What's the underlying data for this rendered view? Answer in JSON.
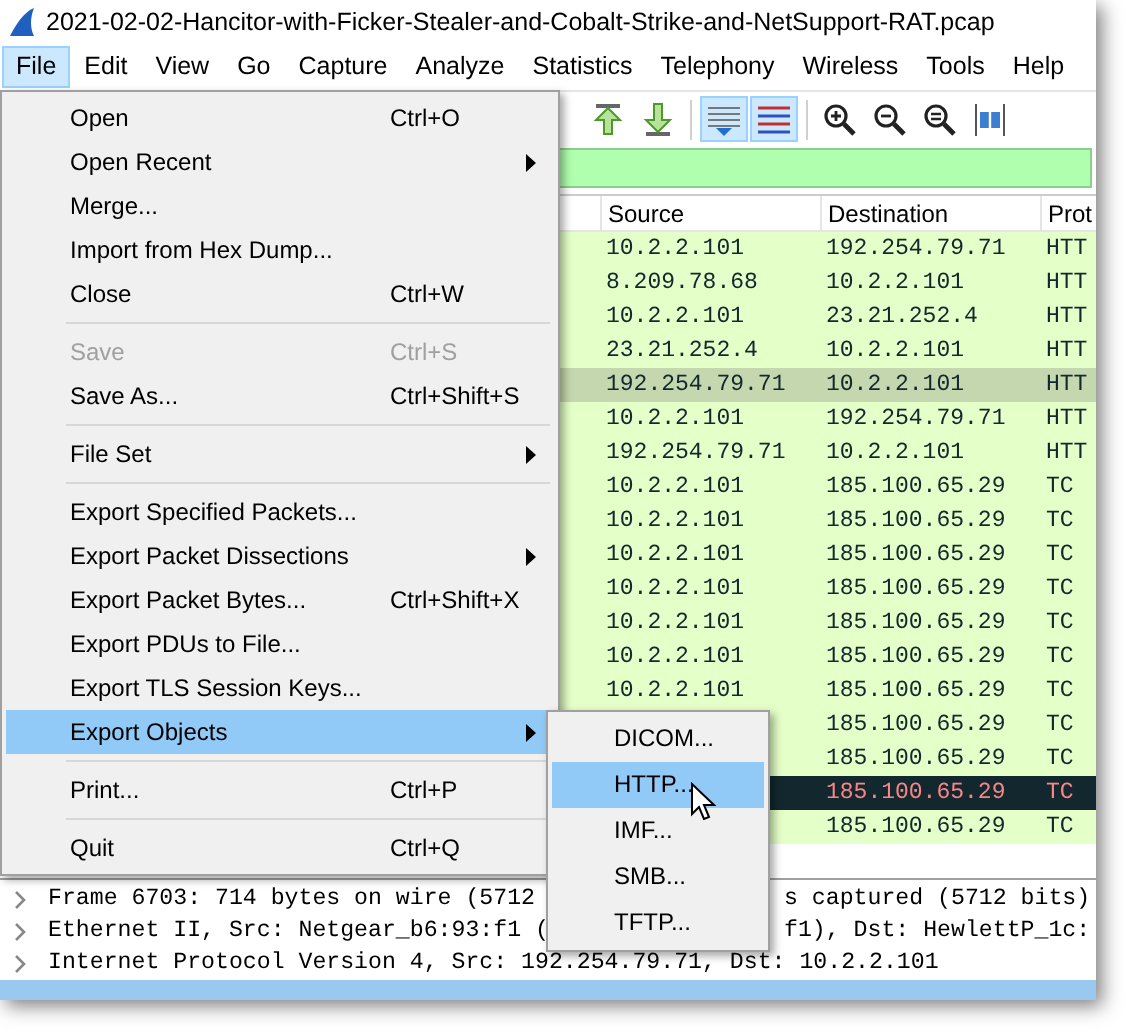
{
  "window": {
    "title": "2021-02-02-Hancitor-with-Ficker-Stealer-and-Cobalt-Strike-and-NetSupport-RAT.pcap"
  },
  "menubar": [
    {
      "label": "File",
      "selected": true
    },
    {
      "label": "Edit",
      "selected": false
    },
    {
      "label": "View",
      "selected": false
    },
    {
      "label": "Go",
      "selected": false
    },
    {
      "label": "Capture",
      "selected": false
    },
    {
      "label": "Analyze",
      "selected": false
    },
    {
      "label": "Statistics",
      "selected": false
    },
    {
      "label": "Telephony",
      "selected": false
    },
    {
      "label": "Wireless",
      "selected": false
    },
    {
      "label": "Tools",
      "selected": false
    },
    {
      "label": "Help",
      "selected": false
    }
  ],
  "toolbar": [
    {
      "kind": "go-first",
      "pressed": false
    },
    {
      "kind": "go-last",
      "pressed": false
    },
    {
      "kind": "autoscroll",
      "pressed": true
    },
    {
      "kind": "colorize",
      "pressed": true
    },
    {
      "kind": "zoom-in",
      "pressed": false
    },
    {
      "kind": "zoom-out",
      "pressed": false
    },
    {
      "kind": "zoom-reset",
      "pressed": false
    },
    {
      "kind": "resize-columns",
      "pressed": false
    }
  ],
  "packet_list": {
    "columns": [
      "Source",
      "Destination",
      "Prot"
    ],
    "rows": [
      {
        "source": "10.2.2.101",
        "destination": "192.254.79.71",
        "protocol": "HTT",
        "kind": "http",
        "selected": false
      },
      {
        "source": "8.209.78.68",
        "destination": "10.2.2.101",
        "protocol": "HTT",
        "kind": "http",
        "selected": false
      },
      {
        "source": "10.2.2.101",
        "destination": "23.21.252.4",
        "protocol": "HTT",
        "kind": "http",
        "selected": false
      },
      {
        "source": "23.21.252.4",
        "destination": "10.2.2.101",
        "protocol": "HTT",
        "kind": "http",
        "selected": false
      },
      {
        "source": "192.254.79.71",
        "destination": "10.2.2.101",
        "protocol": "HTT",
        "kind": "http",
        "selected": true
      },
      {
        "source": "10.2.2.101",
        "destination": "192.254.79.71",
        "protocol": "HTT",
        "kind": "http",
        "selected": false
      },
      {
        "source": "192.254.79.71",
        "destination": "10.2.2.101",
        "protocol": "HTT",
        "kind": "http",
        "selected": false
      },
      {
        "source": "10.2.2.101",
        "destination": "185.100.65.29",
        "protocol": "TC",
        "kind": "tcp",
        "selected": false
      },
      {
        "source": "10.2.2.101",
        "destination": "185.100.65.29",
        "protocol": "TC",
        "kind": "tcp",
        "selected": false
      },
      {
        "source": "10.2.2.101",
        "destination": "185.100.65.29",
        "protocol": "TC",
        "kind": "tcp",
        "selected": false
      },
      {
        "source": "10.2.2.101",
        "destination": "185.100.65.29",
        "protocol": "TC",
        "kind": "tcp",
        "selected": false
      },
      {
        "source": "10.2.2.101",
        "destination": "185.100.65.29",
        "protocol": "TC",
        "kind": "tcp",
        "selected": false
      },
      {
        "source": "10.2.2.101",
        "destination": "185.100.65.29",
        "protocol": "TC",
        "kind": "tcp",
        "selected": false
      },
      {
        "source": "10.2.2.101",
        "destination": "185.100.65.29",
        "protocol": "TC",
        "kind": "tcp",
        "selected": false
      },
      {
        "destination": "185.100.65.29",
        "protocol": "TC",
        "kind": "tcp",
        "selected": false
      },
      {
        "destination": "185.100.65.29",
        "protocol": "TC",
        "kind": "tcp",
        "selected": false
      },
      {
        "destination": "185.100.65.29",
        "protocol": "TC",
        "kind": "bad-tcp",
        "selected": false
      },
      {
        "destination": "185.100.65.29",
        "protocol": "TC",
        "kind": "tcp",
        "selected": false
      }
    ]
  },
  "details": [
    {
      "segments": [
        "Frame 6703: 714 bytes on wire (5712",
        "s captured (5712 bits)"
      ],
      "expanded": false,
      "selected": false
    },
    {
      "segments": [
        "Ethernet II, Src: Netgear_b6:93:f1 (",
        "f1), Dst: HewlettP_1c:"
      ],
      "expanded": false,
      "selected": false
    },
    {
      "segments": [
        "Internet Protocol Version 4, Src: 192.254.79.71, Dst: 10.2.2.101"
      ],
      "expanded": false,
      "selected": false
    },
    {
      "selected": true
    }
  ],
  "file_menu": {
    "items": [
      {
        "kind": "item",
        "label": "Open",
        "shortcut": "Ctrl+O",
        "submenu": false,
        "disabled": false,
        "selected": false
      },
      {
        "kind": "item",
        "label": "Open Recent",
        "submenu": true,
        "disabled": false,
        "selected": false
      },
      {
        "kind": "item",
        "label": "Merge...",
        "submenu": false,
        "disabled": false,
        "selected": false
      },
      {
        "kind": "item",
        "label": "Import from Hex Dump...",
        "submenu": false,
        "disabled": false,
        "selected": false
      },
      {
        "kind": "item",
        "label": "Close",
        "shortcut": "Ctrl+W",
        "submenu": false,
        "disabled": false,
        "selected": false
      },
      {
        "kind": "separator"
      },
      {
        "kind": "item",
        "label": "Save",
        "shortcut": "Ctrl+S",
        "submenu": false,
        "disabled": true,
        "selected": false
      },
      {
        "kind": "item",
        "label": "Save As...",
        "shortcut": "Ctrl+Shift+S",
        "submenu": false,
        "disabled": false,
        "selected": false
      },
      {
        "kind": "separator"
      },
      {
        "kind": "item",
        "label": "File Set",
        "submenu": true,
        "disabled": false,
        "selected": false
      },
      {
        "kind": "separator"
      },
      {
        "kind": "item",
        "label": "Export Specified Packets...",
        "submenu": false,
        "disabled": false,
        "selected": false
      },
      {
        "kind": "item",
        "label": "Export Packet Dissections",
        "submenu": true,
        "disabled": false,
        "selected": false
      },
      {
        "kind": "item",
        "label": "Export Packet Bytes...",
        "shortcut": "Ctrl+Shift+X",
        "submenu": false,
        "disabled": false,
        "selected": false
      },
      {
        "kind": "item",
        "label": "Export PDUs to File...",
        "submenu": false,
        "disabled": false,
        "selected": false
      },
      {
        "kind": "item",
        "label": "Export TLS Session Keys...",
        "submenu": false,
        "disabled": false,
        "selected": false
      },
      {
        "kind": "item",
        "label": "Export Objects",
        "submenu": true,
        "disabled": false,
        "selected": true
      },
      {
        "kind": "separator"
      },
      {
        "kind": "item",
        "label": "Print...",
        "shortcut": "Ctrl+P",
        "submenu": false,
        "disabled": false,
        "selected": false
      },
      {
        "kind": "separator"
      },
      {
        "kind": "item",
        "label": "Quit",
        "shortcut": "Ctrl+Q",
        "submenu": false,
        "disabled": false,
        "selected": false
      }
    ]
  },
  "export_objects_menu": {
    "items": [
      {
        "label": "DICOM...",
        "selected": false
      },
      {
        "label": "HTTP...",
        "selected": true
      },
      {
        "label": "IMF...",
        "selected": false
      },
      {
        "label": "SMB...",
        "selected": false
      },
      {
        "label": "TFTP...",
        "selected": false
      }
    ]
  }
}
